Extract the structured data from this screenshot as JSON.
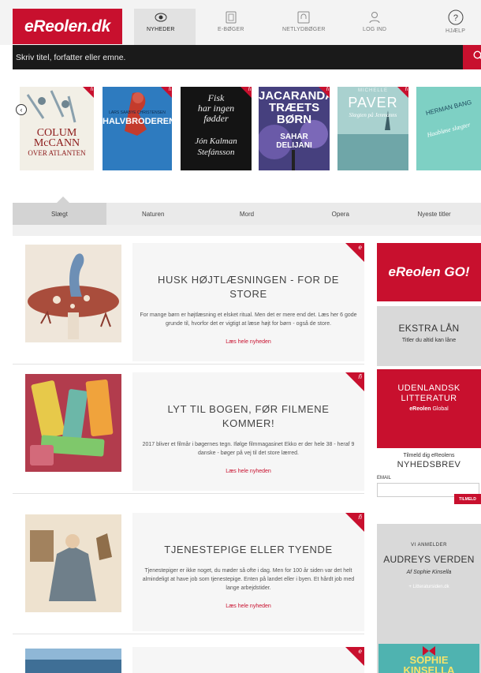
{
  "header": {
    "logo": "eReolen.dk",
    "nav": [
      {
        "label": "NYHEDER",
        "icon": "eye-icon"
      },
      {
        "label": "E-BØGER",
        "icon": "ebook-icon"
      },
      {
        "label": "NETLYDBØGER",
        "icon": "audiobook-icon"
      },
      {
        "label": "LOG IND",
        "icon": "user-icon"
      },
      {
        "label": "HJÆLP",
        "icon": "question-icon"
      }
    ]
  },
  "search": {
    "placeholder": "Skriv titel, forfatter eller emne.",
    "icon": "search-icon"
  },
  "carousel": {
    "covers": [
      {
        "line1": "COLUM",
        "line2": "McCANN",
        "line3": "OVER ATLANTEN"
      },
      {
        "line1": "HALVBRODEREN",
        "line2": "LARS SAABYE CHRISTENSEN"
      },
      {
        "line1": "Fisk",
        "line2": "har ingen",
        "line3": "fødder",
        "line4": "Jón Kalman",
        "line5": "Stefánsson"
      },
      {
        "line1": "JACARANDA",
        "line2": "TRÆETS",
        "line3": "BØRN",
        "line4": "SAHAR",
        "line5": "DELIJANI"
      },
      {
        "line1": "MICHELLE",
        "line2": "PAVER",
        "line3": "Slægten på Jenmanns"
      },
      {
        "line1": "HERMAN BANG",
        "line2": "Haabløse slægter"
      }
    ]
  },
  "tabs": [
    "Slægt",
    "Naturen",
    "Mord",
    "Opera",
    "Nyeste titler"
  ],
  "news": [
    {
      "badge": "e",
      "title": "HUSK HØJTLÆSNINGEN - FOR DE STORE",
      "text": "For mange børn er højtlæsning et elsket ritual. Men det er mere end det. Læs her 6 gode grunde til, hvorfor det er vigtigt at læse højt for børn - også de store.",
      "link": "Læs hele nyheden"
    },
    {
      "badge": "ñ",
      "title": "LYT TIL BOGEN, FØR FILMENE KOMMER!",
      "text": "2017 bliver et filmår i bøgernes tegn. Ifølge filmmagasinet Ekko er der hele 38 - heraf 9 danske - bøger på vej til det store lærred.",
      "link": "Læs hele nyheden"
    },
    {
      "badge": "ñ",
      "title": "TJENESTEPIGE ELLER TYENDE",
      "text": "Tjenestepiger er ikke noget, du møder så ofte i dag. Men for 100 år siden var det helt almindeligt at have job som tjenestepige. Enten på landet eller i byen. Et hårdt job med lange arbejdstider.",
      "link": "Læs hele nyheden"
    },
    {
      "badge": "e"
    }
  ],
  "sidebar": {
    "go": "eReolen GO!",
    "ekstra_title": "EKSTRA LÅN",
    "ekstra_sub": "Titler du altid kan låne",
    "udl_title": "UDENLANDSK LITTERATUR",
    "udl_brand": "eReolen",
    "udl_sub": "Global",
    "nl_pre": "Tilmeld dig eReolens",
    "nl_title": "NYHEDSBREV",
    "nl_label": "EMAIL",
    "nl_button": "TILMELD",
    "anm_kicker": "VI ANMELDER",
    "anm_title": "AUDREYS VERDEN",
    "anm_author": "Af Sophie Kinsella",
    "anm_link": "+ Litteratursiden.dk",
    "book_line1": "SOPHIE",
    "book_line2": "KINSELLA"
  }
}
